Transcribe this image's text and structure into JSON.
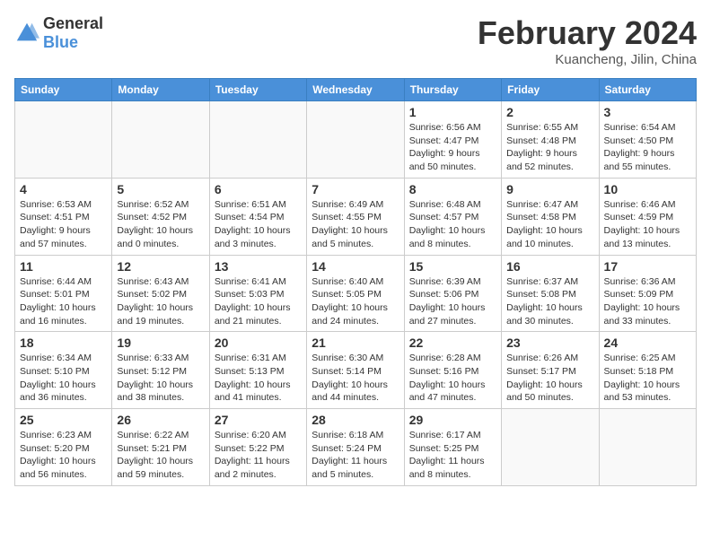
{
  "header": {
    "logo_general": "General",
    "logo_blue": "Blue",
    "month_title": "February 2024",
    "location": "Kuancheng, Jilin, China"
  },
  "days_of_week": [
    "Sunday",
    "Monday",
    "Tuesday",
    "Wednesday",
    "Thursday",
    "Friday",
    "Saturday"
  ],
  "weeks": [
    [
      {
        "day": "",
        "info": ""
      },
      {
        "day": "",
        "info": ""
      },
      {
        "day": "",
        "info": ""
      },
      {
        "day": "",
        "info": ""
      },
      {
        "day": "1",
        "info": "Sunrise: 6:56 AM\nSunset: 4:47 PM\nDaylight: 9 hours\nand 50 minutes."
      },
      {
        "day": "2",
        "info": "Sunrise: 6:55 AM\nSunset: 4:48 PM\nDaylight: 9 hours\nand 52 minutes."
      },
      {
        "day": "3",
        "info": "Sunrise: 6:54 AM\nSunset: 4:50 PM\nDaylight: 9 hours\nand 55 minutes."
      }
    ],
    [
      {
        "day": "4",
        "info": "Sunrise: 6:53 AM\nSunset: 4:51 PM\nDaylight: 9 hours\nand 57 minutes."
      },
      {
        "day": "5",
        "info": "Sunrise: 6:52 AM\nSunset: 4:52 PM\nDaylight: 10 hours\nand 0 minutes."
      },
      {
        "day": "6",
        "info": "Sunrise: 6:51 AM\nSunset: 4:54 PM\nDaylight: 10 hours\nand 3 minutes."
      },
      {
        "day": "7",
        "info": "Sunrise: 6:49 AM\nSunset: 4:55 PM\nDaylight: 10 hours\nand 5 minutes."
      },
      {
        "day": "8",
        "info": "Sunrise: 6:48 AM\nSunset: 4:57 PM\nDaylight: 10 hours\nand 8 minutes."
      },
      {
        "day": "9",
        "info": "Sunrise: 6:47 AM\nSunset: 4:58 PM\nDaylight: 10 hours\nand 10 minutes."
      },
      {
        "day": "10",
        "info": "Sunrise: 6:46 AM\nSunset: 4:59 PM\nDaylight: 10 hours\nand 13 minutes."
      }
    ],
    [
      {
        "day": "11",
        "info": "Sunrise: 6:44 AM\nSunset: 5:01 PM\nDaylight: 10 hours\nand 16 minutes."
      },
      {
        "day": "12",
        "info": "Sunrise: 6:43 AM\nSunset: 5:02 PM\nDaylight: 10 hours\nand 19 minutes."
      },
      {
        "day": "13",
        "info": "Sunrise: 6:41 AM\nSunset: 5:03 PM\nDaylight: 10 hours\nand 21 minutes."
      },
      {
        "day": "14",
        "info": "Sunrise: 6:40 AM\nSunset: 5:05 PM\nDaylight: 10 hours\nand 24 minutes."
      },
      {
        "day": "15",
        "info": "Sunrise: 6:39 AM\nSunset: 5:06 PM\nDaylight: 10 hours\nand 27 minutes."
      },
      {
        "day": "16",
        "info": "Sunrise: 6:37 AM\nSunset: 5:08 PM\nDaylight: 10 hours\nand 30 minutes."
      },
      {
        "day": "17",
        "info": "Sunrise: 6:36 AM\nSunset: 5:09 PM\nDaylight: 10 hours\nand 33 minutes."
      }
    ],
    [
      {
        "day": "18",
        "info": "Sunrise: 6:34 AM\nSunset: 5:10 PM\nDaylight: 10 hours\nand 36 minutes."
      },
      {
        "day": "19",
        "info": "Sunrise: 6:33 AM\nSunset: 5:12 PM\nDaylight: 10 hours\nand 38 minutes."
      },
      {
        "day": "20",
        "info": "Sunrise: 6:31 AM\nSunset: 5:13 PM\nDaylight: 10 hours\nand 41 minutes."
      },
      {
        "day": "21",
        "info": "Sunrise: 6:30 AM\nSunset: 5:14 PM\nDaylight: 10 hours\nand 44 minutes."
      },
      {
        "day": "22",
        "info": "Sunrise: 6:28 AM\nSunset: 5:16 PM\nDaylight: 10 hours\nand 47 minutes."
      },
      {
        "day": "23",
        "info": "Sunrise: 6:26 AM\nSunset: 5:17 PM\nDaylight: 10 hours\nand 50 minutes."
      },
      {
        "day": "24",
        "info": "Sunrise: 6:25 AM\nSunset: 5:18 PM\nDaylight: 10 hours\nand 53 minutes."
      }
    ],
    [
      {
        "day": "25",
        "info": "Sunrise: 6:23 AM\nSunset: 5:20 PM\nDaylight: 10 hours\nand 56 minutes."
      },
      {
        "day": "26",
        "info": "Sunrise: 6:22 AM\nSunset: 5:21 PM\nDaylight: 10 hours\nand 59 minutes."
      },
      {
        "day": "27",
        "info": "Sunrise: 6:20 AM\nSunset: 5:22 PM\nDaylight: 11 hours\nand 2 minutes."
      },
      {
        "day": "28",
        "info": "Sunrise: 6:18 AM\nSunset: 5:24 PM\nDaylight: 11 hours\nand 5 minutes."
      },
      {
        "day": "29",
        "info": "Sunrise: 6:17 AM\nSunset: 5:25 PM\nDaylight: 11 hours\nand 8 minutes."
      },
      {
        "day": "",
        "info": ""
      },
      {
        "day": "",
        "info": ""
      }
    ]
  ]
}
